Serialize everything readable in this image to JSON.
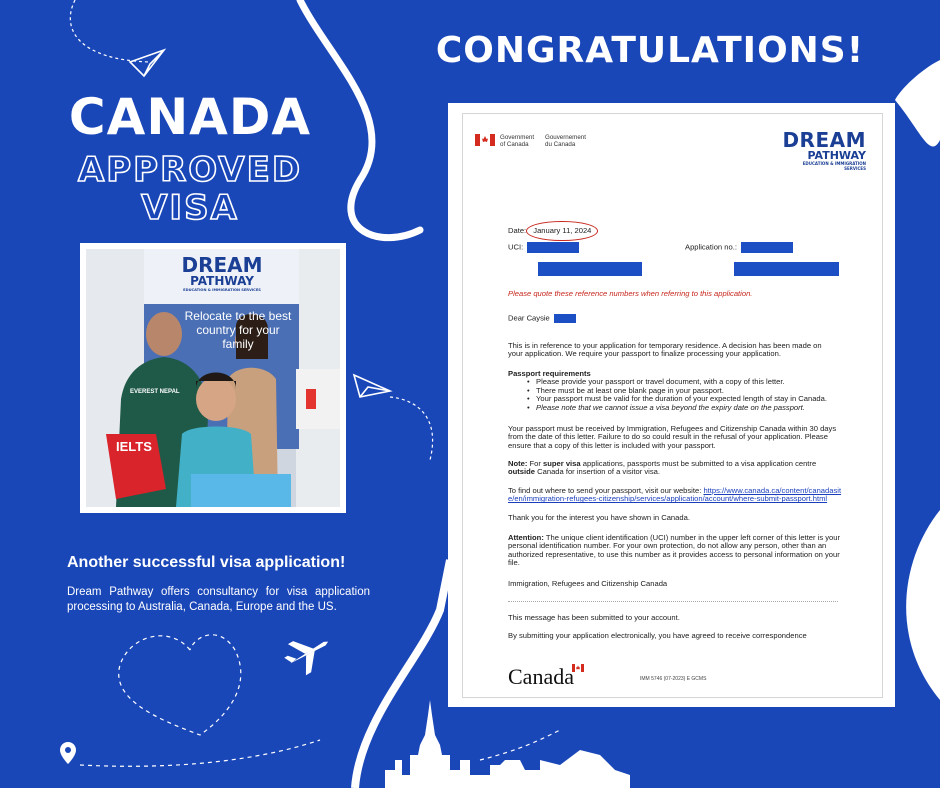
{
  "heading": "CONGRATULATIONS!",
  "left_title": {
    "line1": "CANADA",
    "line2": "APPROVED",
    "line3": "VISA"
  },
  "photo": {
    "banner_brand_line1": "DREAM",
    "banner_brand_line2": "PATHWAY",
    "banner_brand_line3": "EDUCATION & IMMIGRATION SERVICES",
    "banner_text": "Relocate to the best country for your family",
    "bag_text": "IELTS",
    "shirt_text": "EVEREST NEPAL"
  },
  "subheading": "Another successful visa application!",
  "subtext": "Dream Pathway offers consultancy for visa application processing to Australia, Canada, Europe and the US.",
  "letter": {
    "gov_en": "Government of Canada",
    "gov_fr": "Gouvernement du Canada",
    "logo_line1": "DREAM",
    "logo_line2": "PATHWAY",
    "logo_line3": "EDUCATION & IMMIGRATION SERVICES",
    "date_label": "Date:",
    "date_value": "January 11, 2024",
    "uci_label": "UCI:",
    "app_label": "Application no.:",
    "quote_note": "Please quote these reference numbers when referring to this application.",
    "dear": "Dear Caysie",
    "para1": "This is in reference to your application for temporary residence. A decision has been made on your application. We require your passport to finalize processing your application.",
    "passport_heading": "Passport requirements",
    "bullets": [
      "Please provide your passport or travel document, with a copy of this letter.",
      "There must be at least one blank page in your passport.",
      "Your passport must be valid for the duration of your expected length of stay in Canada.",
      "Please note that we cannot issue a visa beyond the expiry date on the passport."
    ],
    "para2": "Your passport must be received by Immigration, Refugees and Citizenship Canada within 30 days from the date of this letter. Failure to do so could result in the refusal of your application. Please ensure that a copy of this letter is included with your passport.",
    "note_label": "Note:",
    "note_a": "For",
    "note_bold1": "super visa",
    "note_b": "applications, passports must be submitted to a visa application centre",
    "note_bold2": "outside",
    "note_c": "Canada for insertion of a visitor visa.",
    "find_text": "To find out where to send your passport, visit our website:",
    "link": "https://www.canada.ca/content/canadasite/en/immigration-refugees-citizenship/services/application/account/where-submit-passport.html",
    "thanks": "Thank you for the interest you have shown in Canada.",
    "attention_label": "Attention:",
    "attention_text": "The unique client identification (UCI) number in the upper left corner of this letter is your personal identification number. For your own protection, do not allow any person, other than an authorized representative, to use this number as it provides access to personal information on your file.",
    "signoff": "Immigration, Refugees and Citizenship Canada",
    "submitted": "This message has been submitted to your account.",
    "agreed": "By submitting your application electronically, you have agreed to receive correspondence",
    "canada_wordmark": "Canada",
    "footer_code": "IMM 5746 (07-2023) E GCMS"
  },
  "colors": {
    "background": "#1a47b8",
    "redaction": "#1c4fc3",
    "date_circle": "#c7261c",
    "brand_navy": "#1b3f95"
  }
}
